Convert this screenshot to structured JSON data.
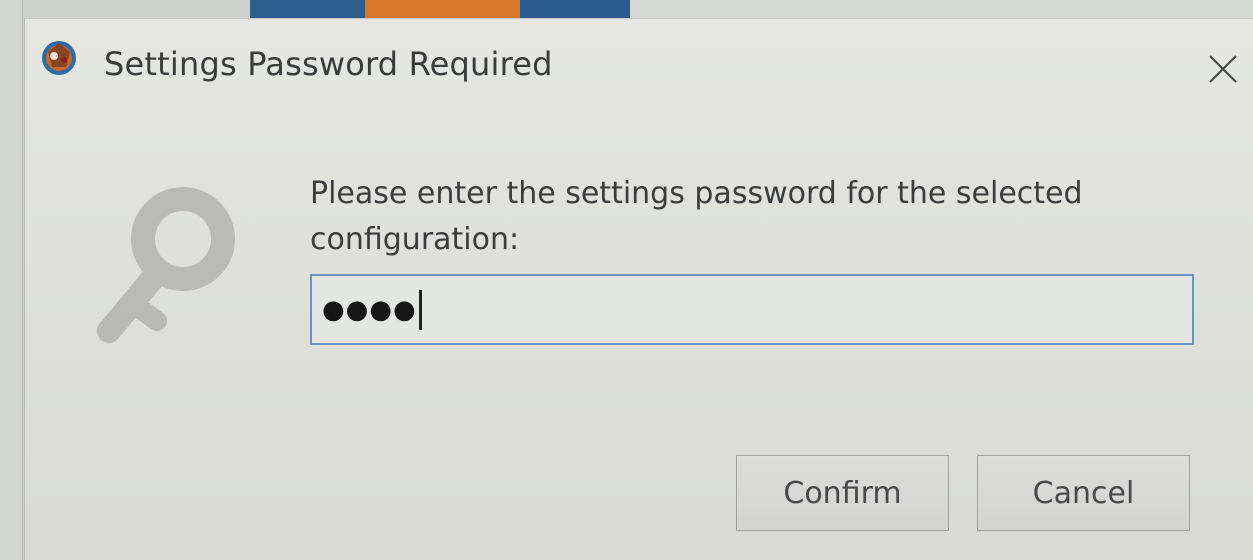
{
  "window": {
    "title": "Settings Password Required",
    "app_icon": "app-logo-icon",
    "close_icon": "close-icon"
  },
  "content": {
    "icon": "key-icon",
    "prompt": "Please enter the settings password for the selected configuration:"
  },
  "password_field": {
    "masked_value": "●●●●"
  },
  "buttons": {
    "confirm_label": "Confirm",
    "cancel_label": "Cancel"
  },
  "colors": {
    "field_border": "#6d93bf",
    "text": "#3a3b3c",
    "dialog_bg": "#e2e3df"
  }
}
